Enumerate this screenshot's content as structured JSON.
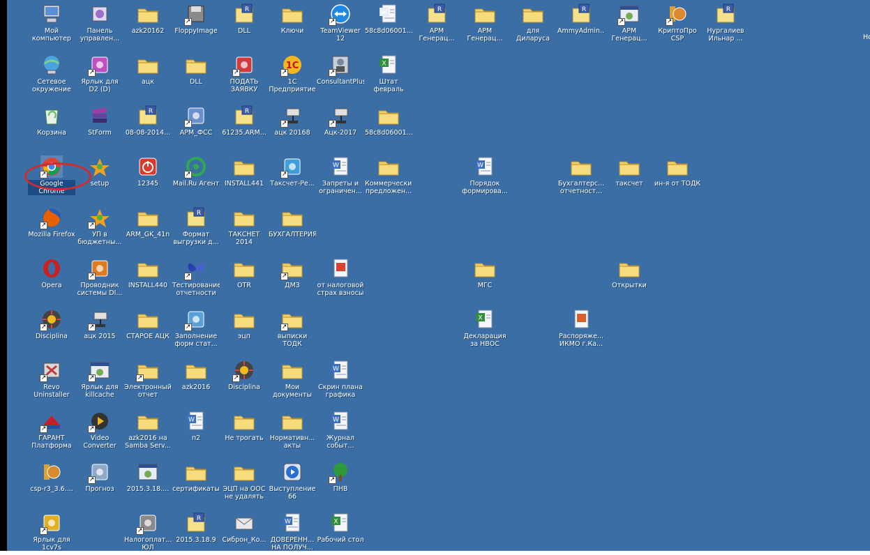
{
  "desktop": {
    "background_color": "#3a6ea5",
    "edge_label": "Hc",
    "icons": [
      {
        "label": "Мой компьютер",
        "icon": "my-computer-icon",
        "color": "#5c8fd6",
        "col": 0,
        "row": 0,
        "shortcut": false
      },
      {
        "label": "Панель управлен...",
        "icon": "control-panel-icon",
        "color": "#9b6fc4",
        "col": 1,
        "row": 0,
        "shortcut": false
      },
      {
        "label": "azk20162",
        "icon": "folder-icon",
        "color": "#f2d06b",
        "col": 2,
        "row": 0,
        "shortcut": false
      },
      {
        "label": "FloppyImage",
        "icon": "floppy-icon",
        "color": "#8a8a8a",
        "col": 3,
        "row": 0,
        "shortcut": true
      },
      {
        "label": "DLL",
        "icon": "archive-icon",
        "color": "#f5e08c",
        "col": 4,
        "row": 0,
        "shortcut": false
      },
      {
        "label": "Ключи",
        "icon": "folder-icon",
        "color": "#f2d06b",
        "col": 5,
        "row": 0,
        "shortcut": false
      },
      {
        "label": "TeamViewer 12",
        "icon": "teamviewer-icon",
        "color": "#1e88e5",
        "col": 6,
        "row": 0,
        "shortcut": true
      },
      {
        "label": "58c8d06001...",
        "icon": "document-icon",
        "color": "#e8eef8",
        "col": 7,
        "row": 0,
        "shortcut": false
      },
      {
        "label": "АРМ Генерац...",
        "icon": "archive-icon",
        "color": "#f5e08c",
        "col": 8,
        "row": 0,
        "shortcut": false
      },
      {
        "label": "АРМ Генерац...",
        "icon": "folder-icon",
        "color": "#f2d06b",
        "col": 9,
        "row": 0,
        "shortcut": false
      },
      {
        "label": "для Диларуса",
        "icon": "folder-icon",
        "color": "#f2d06b",
        "col": 10,
        "row": 0,
        "shortcut": false
      },
      {
        "label": "AmmyAdmin...",
        "icon": "archive-icon",
        "color": "#f5e08c",
        "col": 11,
        "row": 0,
        "shortcut": false
      },
      {
        "label": "АРМ Генерац...",
        "icon": "app-window-icon",
        "color": "#bfc7d5",
        "col": 12,
        "row": 0,
        "shortcut": true
      },
      {
        "label": "КриптоПро CSP",
        "icon": "cryptopro-icon",
        "color": "#e0a030",
        "col": 13,
        "row": 0,
        "shortcut": true
      },
      {
        "label": "Нургалиев Ильнар ...",
        "icon": "archive-icon",
        "color": "#f5e08c",
        "col": 14,
        "row": 0,
        "shortcut": false
      },
      {
        "label": "Сетевое окружение",
        "icon": "network-icon",
        "color": "#4aa3df",
        "col": 0,
        "row": 1,
        "shortcut": false
      },
      {
        "label": "Ярлык для D2 (D)",
        "icon": "shortcut-icon",
        "color": "#c04fc0",
        "col": 1,
        "row": 1,
        "shortcut": true
      },
      {
        "label": "ацк",
        "icon": "folder-icon",
        "color": "#f2d06b",
        "col": 2,
        "row": 1,
        "shortcut": false
      },
      {
        "label": "DLL",
        "icon": "folder-icon",
        "color": "#f2d06b",
        "col": 3,
        "row": 1,
        "shortcut": false
      },
      {
        "label": "ПОДАТЬ ЗАЯВКУ",
        "icon": "app-icon",
        "color": "#d03c3c",
        "col": 4,
        "row": 1,
        "shortcut": true
      },
      {
        "label": "1С Предприятие",
        "icon": "onec-icon",
        "color": "#f2b820",
        "col": 5,
        "row": 1,
        "shortcut": true
      },
      {
        "label": "ConsultantPlus",
        "icon": "consultant-icon",
        "color": "#7a8aa0",
        "col": 6,
        "row": 1,
        "shortcut": true
      },
      {
        "label": "Штат февраль",
        "icon": "excel-icon",
        "color": "#2f8f3f",
        "col": 7,
        "row": 1,
        "shortcut": false
      },
      {
        "label": "Корзина",
        "icon": "recycle-bin-icon",
        "color": "#6fbf6f",
        "col": 0,
        "row": 2,
        "shortcut": false
      },
      {
        "label": "StForm",
        "icon": "books-icon",
        "color": "#9c3fa0",
        "col": 1,
        "row": 2,
        "shortcut": false
      },
      {
        "label": "08-08-2014...",
        "icon": "archive-icon",
        "color": "#f5e08c",
        "col": 2,
        "row": 2,
        "shortcut": false
      },
      {
        "label": "АРМ_ФСС",
        "icon": "app-icon",
        "color": "#6c8fd0",
        "col": 3,
        "row": 2,
        "shortcut": true
      },
      {
        "label": "61235.ARM...",
        "icon": "archive-icon",
        "color": "#f5e08c",
        "col": 4,
        "row": 2,
        "shortcut": false
      },
      {
        "label": "ацк 20168",
        "icon": "network-drive-icon",
        "color": "#9aa6b2",
        "col": 5,
        "row": 2,
        "shortcut": true
      },
      {
        "label": "Ацк-2017",
        "icon": "network-drive-icon",
        "color": "#9aa6b2",
        "col": 6,
        "row": 2,
        "shortcut": true
      },
      {
        "label": "58c8d06001...",
        "icon": "folder-icon",
        "color": "#f2d06b",
        "col": 7,
        "row": 2,
        "shortcut": false
      },
      {
        "label": "Google Chrome",
        "icon": "chrome-icon",
        "color": "#4285f4",
        "col": 0,
        "row": 3,
        "shortcut": true,
        "selected": true
      },
      {
        "label": "setup",
        "icon": "setup-icon",
        "color": "#f6a019",
        "col": 1,
        "row": 3,
        "shortcut": false
      },
      {
        "label": "12345",
        "icon": "power-icon",
        "color": "#d83b2b",
        "col": 2,
        "row": 3,
        "shortcut": false
      },
      {
        "label": "Mail.Ru Агент",
        "icon": "mail-agent-icon",
        "color": "#2fa84f",
        "col": 3,
        "row": 3,
        "shortcut": true
      },
      {
        "label": "INSTALL441",
        "icon": "folder-icon",
        "color": "#f2d06b",
        "col": 4,
        "row": 3,
        "shortcut": false
      },
      {
        "label": "Таксчет-Ре...",
        "icon": "app-icon",
        "color": "#3f9fd9",
        "col": 5,
        "row": 3,
        "shortcut": true
      },
      {
        "label": "Запреты и ограничен...",
        "icon": "word-icon",
        "color": "#3b6fc4",
        "col": 6,
        "row": 3,
        "shortcut": false
      },
      {
        "label": "Коммерческие предложен...",
        "icon": "folder-icon",
        "color": "#f2d06b",
        "col": 7,
        "row": 3,
        "shortcut": false
      },
      {
        "label": "Порядок формирова...",
        "icon": "word-icon",
        "color": "#3b6fc4",
        "col": 9,
        "row": 3,
        "shortcut": false
      },
      {
        "label": "Бухгалтерс... отчетност...",
        "icon": "folder-icon",
        "color": "#f2d06b",
        "col": 11,
        "row": 3,
        "shortcut": false
      },
      {
        "label": "таксчет",
        "icon": "folder-icon",
        "color": "#f2d06b",
        "col": 12,
        "row": 3,
        "shortcut": false
      },
      {
        "label": "ин-я от ТОДК",
        "icon": "folder-icon",
        "color": "#f2d06b",
        "col": 13,
        "row": 3,
        "shortcut": false
      },
      {
        "label": "Mozilla Firefox",
        "icon": "firefox-icon",
        "color": "#e66000",
        "col": 0,
        "row": 4,
        "shortcut": true
      },
      {
        "label": "УП в бюджетны...",
        "icon": "setup-icon",
        "color": "#f6a019",
        "col": 1,
        "row": 4,
        "shortcut": true
      },
      {
        "label": "ARM_GK_41n",
        "icon": "folder-icon",
        "color": "#f2d06b",
        "col": 2,
        "row": 4,
        "shortcut": false
      },
      {
        "label": "Формат выгрузки д...",
        "icon": "archive-icon",
        "color": "#f5e08c",
        "col": 3,
        "row": 4,
        "shortcut": false
      },
      {
        "label": "ТАКСНЕТ 2014",
        "icon": "folder-icon",
        "color": "#f2d06b",
        "col": 4,
        "row": 4,
        "shortcut": false
      },
      {
        "label": "БУХГАЛТЕРИЯ",
        "icon": "folder-icon",
        "color": "#f2d06b",
        "col": 5,
        "row": 4,
        "shortcut": false
      },
      {
        "label": "Opera",
        "icon": "opera-icon",
        "color": "#cc1f1f",
        "col": 0,
        "row": 5,
        "shortcut": false
      },
      {
        "label": "Проводник системы DI...",
        "icon": "app-icon",
        "color": "#e07a1f",
        "col": 1,
        "row": 5,
        "shortcut": true
      },
      {
        "label": "INSTALL440",
        "icon": "folder-icon",
        "color": "#f2d06b",
        "col": 2,
        "row": 5,
        "shortcut": false
      },
      {
        "label": "Тестирование отчетности",
        "icon": "butterfly-icon",
        "color": "#2a3fb0",
        "col": 3,
        "row": 5,
        "shortcut": true
      },
      {
        "label": "OTR",
        "icon": "folder-icon",
        "color": "#f2d06b",
        "col": 4,
        "row": 5,
        "shortcut": false
      },
      {
        "label": "ДМЗ",
        "icon": "folder-icon",
        "color": "#f2d06b",
        "col": 5,
        "row": 5,
        "shortcut": true
      },
      {
        "label": "от налоговой страх взносы",
        "icon": "pdf-icon",
        "color": "#d8432f",
        "col": 6,
        "row": 5,
        "shortcut": false
      },
      {
        "label": "МГС",
        "icon": "folder-icon",
        "color": "#f2d06b",
        "col": 9,
        "row": 5,
        "shortcut": false
      },
      {
        "label": "Открытки",
        "icon": "folder-icon",
        "color": "#f2d06b",
        "col": 12,
        "row": 5,
        "shortcut": false
      },
      {
        "label": "Disciplina",
        "icon": "disciplina-icon",
        "color": "#444444",
        "col": 0,
        "row": 6,
        "shortcut": true
      },
      {
        "label": "ацк 2015",
        "icon": "network-drive-icon",
        "color": "#9aa6b2",
        "col": 1,
        "row": 6,
        "shortcut": true
      },
      {
        "label": "СТАРОЕ АЦК",
        "icon": "folder-icon",
        "color": "#f2d06b",
        "col": 2,
        "row": 6,
        "shortcut": false
      },
      {
        "label": "Заполнение форм стат...",
        "icon": "app-icon",
        "color": "#5aa0d8",
        "col": 3,
        "row": 6,
        "shortcut": true
      },
      {
        "label": "эцп",
        "icon": "folder-icon",
        "color": "#f2d06b",
        "col": 4,
        "row": 6,
        "shortcut": false
      },
      {
        "label": "выписки ТОДК",
        "icon": "folder-icon",
        "color": "#f2d06b",
        "col": 5,
        "row": 6,
        "shortcut": true
      },
      {
        "label": "Декларация за НВОС",
        "icon": "excel-icon",
        "color": "#2f8f3f",
        "col": 9,
        "row": 6,
        "shortcut": false
      },
      {
        "label": "Распоряже... ИКМО г.Ка...",
        "icon": "image-icon",
        "color": "#d8602f",
        "col": 11,
        "row": 6,
        "shortcut": false
      },
      {
        "label": "Revo Uninstaller",
        "icon": "revo-icon",
        "color": "#c23b3b",
        "col": 0,
        "row": 7,
        "shortcut": true
      },
      {
        "label": "Ярлык для killcache",
        "icon": "app-window-icon",
        "color": "#bfc7d5",
        "col": 1,
        "row": 7,
        "shortcut": true
      },
      {
        "label": "Электронный отчет",
        "icon": "folder-icon",
        "color": "#f2d06b",
        "col": 2,
        "row": 7,
        "shortcut": true
      },
      {
        "label": "azk2016",
        "icon": "folder-icon",
        "color": "#f2d06b",
        "col": 3,
        "row": 7,
        "shortcut": false
      },
      {
        "label": "Disciplina",
        "icon": "disciplina-icon",
        "color": "#444444",
        "col": 4,
        "row": 7,
        "shortcut": true
      },
      {
        "label": "Мои документы",
        "icon": "my-documents-icon",
        "color": "#f2d06b",
        "col": 5,
        "row": 7,
        "shortcut": false
      },
      {
        "label": "Скрин плана графика",
        "icon": "word-icon",
        "color": "#3b6fc4",
        "col": 6,
        "row": 7,
        "shortcut": false
      },
      {
        "label": "ГАРАНТ Платформа ...",
        "icon": "garant-icon",
        "color": "#c41e2a",
        "col": 0,
        "row": 8,
        "shortcut": true
      },
      {
        "label": "Video Converter",
        "icon": "video-converter-icon",
        "color": "#333333",
        "col": 1,
        "row": 8,
        "shortcut": true
      },
      {
        "label": "azk2016 на Samba Serv...",
        "icon": "folder-icon",
        "color": "#f2d06b",
        "col": 2,
        "row": 8,
        "shortcut": false
      },
      {
        "label": "п2",
        "icon": "word-icon",
        "color": "#3b6fc4",
        "col": 3,
        "row": 8,
        "shortcut": false
      },
      {
        "label": "Не трогать",
        "icon": "folder-icon",
        "color": "#f2d06b",
        "col": 4,
        "row": 8,
        "shortcut": false
      },
      {
        "label": "Нормативн... акты",
        "icon": "folder-icon",
        "color": "#f2d06b",
        "col": 5,
        "row": 8,
        "shortcut": false
      },
      {
        "label": "Журнал событ...",
        "icon": "word-icon",
        "color": "#3b6fc4",
        "col": 6,
        "row": 8,
        "shortcut": false
      },
      {
        "label": "csp-r3_3.6....",
        "icon": "cryptopro-icon",
        "color": "#e0a030",
        "col": 0,
        "row": 9,
        "shortcut": false
      },
      {
        "label": "Прогноз",
        "icon": "app-icon",
        "color": "#8fa7c9",
        "col": 1,
        "row": 9,
        "shortcut": true
      },
      {
        "label": "2015.3.18....",
        "icon": "app-window-icon",
        "color": "#bfc7d5",
        "col": 2,
        "row": 9,
        "shortcut": false
      },
      {
        "label": "сертификаты",
        "icon": "folder-icon",
        "color": "#f2d06b",
        "col": 3,
        "row": 9,
        "shortcut": false
      },
      {
        "label": "ЭЦП на ООС не удалять",
        "icon": "folder-icon",
        "color": "#f2d06b",
        "col": 4,
        "row": 9,
        "shortcut": false
      },
      {
        "label": "Выступление 66",
        "icon": "media-icon",
        "color": "#2a6fd0",
        "col": 5,
        "row": 9,
        "shortcut": false
      },
      {
        "label": "ПНВ",
        "icon": "tree-icon",
        "color": "#2e9b3a",
        "col": 6,
        "row": 9,
        "shortcut": true
      },
      {
        "label": "Ярлык для 1cv7s",
        "icon": "shortcut-icon",
        "color": "#e0b020",
        "col": 0,
        "row": 10,
        "shortcut": true
      },
      {
        "label": "Налогоплат... ЮЛ",
        "icon": "app-icon",
        "color": "#8a8a8a",
        "col": 2,
        "row": 10,
        "shortcut": true
      },
      {
        "label": "2015.3.18.9",
        "icon": "archive-icon",
        "color": "#f5e08c",
        "col": 3,
        "row": 10,
        "shortcut": false
      },
      {
        "label": "Сиброн_Ко...",
        "icon": "mail-icon",
        "color": "#e8e8e8",
        "col": 4,
        "row": 10,
        "shortcut": false
      },
      {
        "label": "ДОВЕРЕНН... НА ПОЛУЧ...",
        "icon": "word-icon",
        "color": "#3b6fc4",
        "col": 5,
        "row": 10,
        "shortcut": false
      },
      {
        "label": "Рабочий стол",
        "icon": "excel-icon",
        "color": "#2f8f3f",
        "col": 6,
        "row": 10,
        "shortcut": false
      }
    ]
  }
}
